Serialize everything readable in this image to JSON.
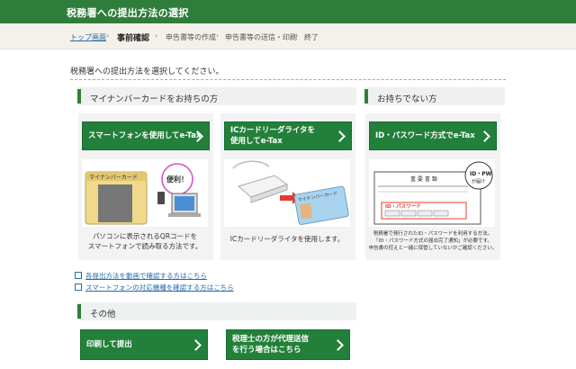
{
  "header": {
    "title": "税務署への提出方法の選択"
  },
  "breadcrumb": {
    "home": "トップ画面",
    "steps": [
      "事前確認",
      "申告書等の作成",
      "申告書等の送信・印刷",
      "終了"
    ]
  },
  "instruction": "税務署への提出方法を選択してください。",
  "section_mynumber": {
    "heading": "マイナンバーカードをお持ちの方",
    "cards": [
      {
        "button": "スマートフォンを使用してe-Tax",
        "illus": {
          "card_label": "マイナンバーカード",
          "bubble": "便利！"
        },
        "caption": [
          "パソコンに表示されるQRコードを",
          "スマートフォンで読み取る方法です。"
        ]
      },
      {
        "button_lines": [
          "ICカードリーダライタを",
          "使用してe-Tax"
        ],
        "illus": {
          "card_label": "マイナンバーカード"
        },
        "caption": [
          "ICカードリーダライタを使用します。"
        ]
      }
    ]
  },
  "section_nocard": {
    "heading": "お持ちでない方",
    "card": {
      "button": "ID・パスワード方式でe-Tax",
      "illus": {
        "doc_title": "重 要 書 類",
        "badge": [
          "ID・PW",
          "が届け"
        ],
        "id_label": "ID・パスワード"
      },
      "caption": [
        "税務署で発行されたID・パスワードを利用する方法。",
        "「ID・パスワード方式の届出完了通知」が必要です。",
        "申告書の控えと一緒に保管していないかご確認ください。"
      ]
    }
  },
  "links": [
    "各提出方法を動画で確認する方はこちら",
    "スマートフォンの対応機種を確認する方はこちら"
  ],
  "section_other": {
    "heading": "その他",
    "buttons": [
      {
        "label": "印刷して提出"
      },
      {
        "label_lines": [
          "税理士の方が代理送信",
          "を行う場合はこちら"
        ]
      }
    ]
  },
  "colors": {
    "primary_green": "#23803a",
    "header_green": "#2f7d3a",
    "link_blue": "#2a6aa8"
  }
}
